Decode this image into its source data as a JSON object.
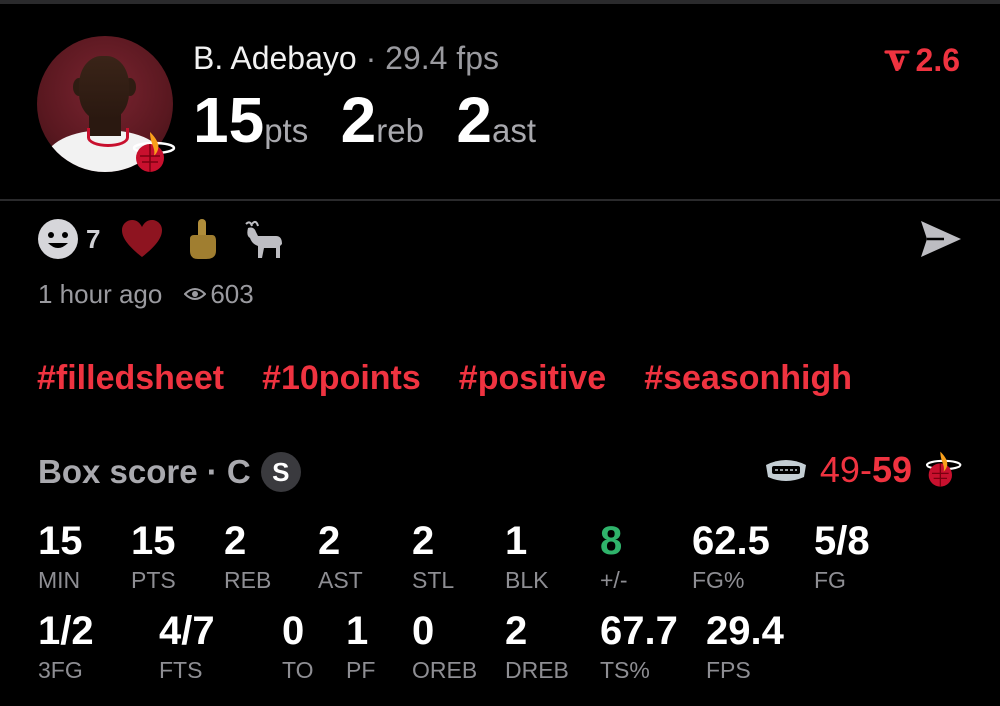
{
  "player": {
    "name": "B. Adebayo",
    "separator": "·",
    "fps": "29.4 fps",
    "rating_change": "2.6",
    "headline": [
      {
        "value": "15",
        "unit": "pts"
      },
      {
        "value": "2",
        "unit": "reb"
      },
      {
        "value": "2",
        "unit": "ast"
      }
    ]
  },
  "reactions": [
    {
      "icon": "smiley-icon",
      "count": "7"
    },
    {
      "icon": "heart-icon",
      "count": ""
    },
    {
      "icon": "middle-finger-icon",
      "count": ""
    },
    {
      "icon": "goat-icon",
      "count": ""
    }
  ],
  "meta": {
    "time": "1 hour ago",
    "views": "603"
  },
  "hashtags": [
    "#filledsheet",
    "#10points",
    "#positive",
    "#seasonhigh"
  ],
  "box_score": {
    "title": "Box score",
    "position": "· C",
    "badge": "S",
    "away_score": "49",
    "dash": "-",
    "home_score": "59",
    "row1": [
      {
        "value": "15",
        "label": "MIN"
      },
      {
        "value": "15",
        "label": "PTS"
      },
      {
        "value": "2",
        "label": "REB"
      },
      {
        "value": "2",
        "label": "AST"
      },
      {
        "value": "2",
        "label": "STL"
      },
      {
        "value": "1",
        "label": "BLK"
      },
      {
        "value": "8",
        "label": "+/-"
      },
      {
        "value": "62.5",
        "label": "FG%"
      },
      {
        "value": "5/8",
        "label": "FG"
      }
    ],
    "row2": [
      {
        "value": "1/2",
        "label": "3FG"
      },
      {
        "value": "4/7",
        "label": "FTS"
      },
      {
        "value": "0",
        "label": "TO"
      },
      {
        "value": "1",
        "label": "PF"
      },
      {
        "value": "0",
        "label": "OREB"
      },
      {
        "value": "2",
        "label": "DREB"
      },
      {
        "value": "67.7",
        "label": "TS%"
      },
      {
        "value": "29.4",
        "label": "FPS"
      }
    ]
  },
  "colors": {
    "accent": "#ef3340",
    "positive": "#2fb36b",
    "muted": "#9a9a9f",
    "background": "#000000"
  }
}
